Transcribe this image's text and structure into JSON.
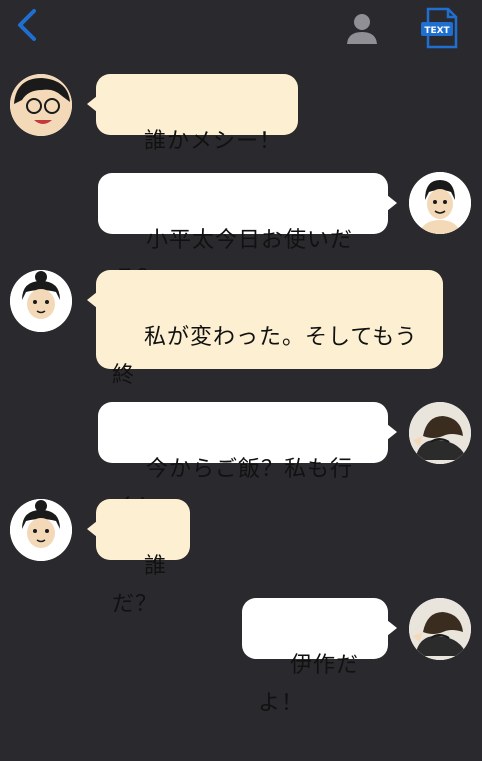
{
  "header": {
    "back_icon": "chevron-left-icon",
    "profile_icon": "person-icon",
    "text_icon": "text-document-icon",
    "text_icon_label": "TEXT",
    "accent_color": "#1f6fd1"
  },
  "messages": [
    {
      "side": "left",
      "avatar": "guy-glasses-avatar",
      "text": "誰かメシー！"
    },
    {
      "side": "right",
      "avatar": "boy-shirtless-avatar",
      "text": "小平太今日お使いだろ？"
    },
    {
      "side": "left",
      "avatar": "girl-bun-avatar",
      "text": "私が変わった。そしてもう終\nわったぞ"
    },
    {
      "side": "right",
      "avatar": "masked-ninja-avatar",
      "text": "今からご飯？私も行く！"
    },
    {
      "side": "left",
      "avatar": "girl-bun-avatar",
      "text": "誰だ？"
    },
    {
      "side": "right",
      "avatar": "masked-ninja-avatar",
      "text": "伊作だよ！"
    }
  ]
}
